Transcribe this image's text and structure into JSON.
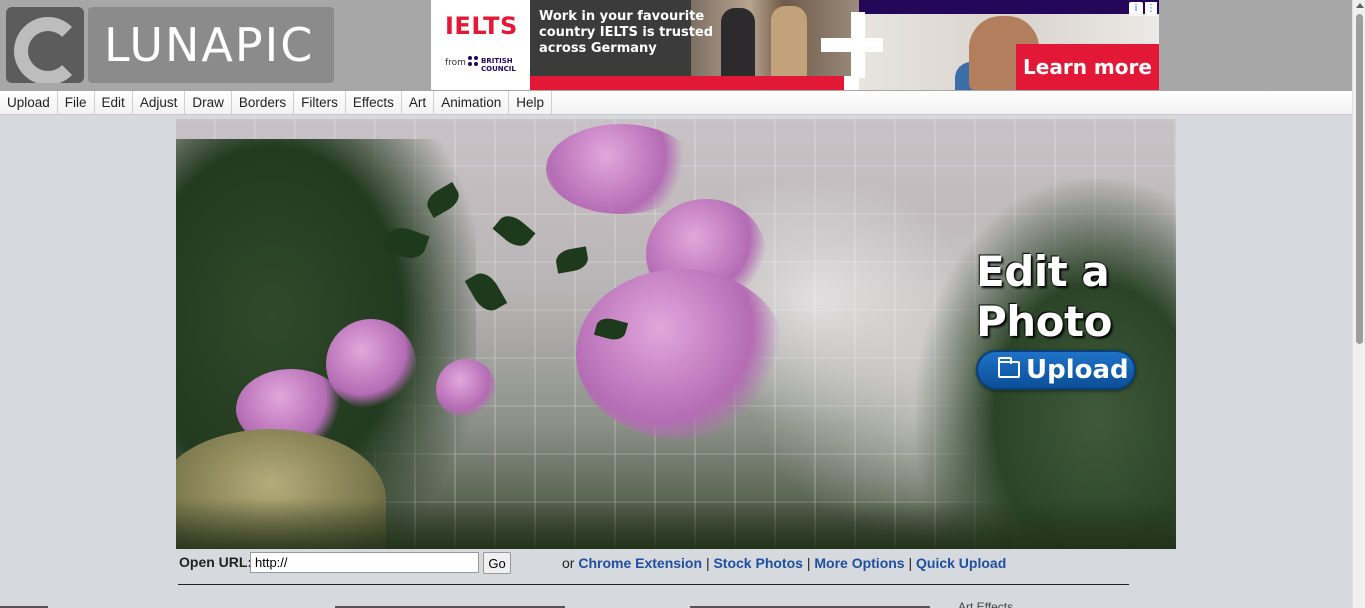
{
  "logo": {
    "text": "LUNAPIC"
  },
  "ad": {
    "brand": "IELTS",
    "from_label": "from",
    "partner": "BRITISH COUNCIL",
    "headline": "Work in your favourite country IELTS is trusted across Germany",
    "cta": "Learn more",
    "info_icon": "i",
    "menu_icon": "⋮"
  },
  "menu": [
    "Upload",
    "File",
    "Edit",
    "Adjust",
    "Draw",
    "Borders",
    "Filters",
    "Effects",
    "Art",
    "Animation",
    "Help"
  ],
  "hero": {
    "title_line1": "Edit a",
    "title_line2": "Photo",
    "upload_label": "Upload"
  },
  "url_row": {
    "label": "Open URL:",
    "input_value": "http://",
    "go_label": "Go",
    "or_text": "or",
    "links": [
      "Chrome Extension",
      "Stock Photos",
      "More Options",
      "Quick Upload"
    ],
    "separator": "|"
  },
  "footer": {
    "partial_text": "Art Effects"
  },
  "colors": {
    "accent": "#1f73c9",
    "link": "#1f4f9e",
    "ad_red": "#e31837",
    "header_bg": "#a7a7a7",
    "page_bg": "#d6d9de"
  }
}
